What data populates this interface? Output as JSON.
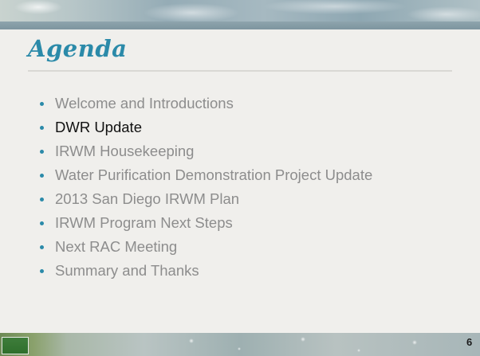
{
  "slide": {
    "title": "Agenda",
    "items": [
      {
        "label": "Welcome and Introductions",
        "active": false
      },
      {
        "label": "DWR Update",
        "active": true
      },
      {
        "label": "IRWM Housekeeping",
        "active": false
      },
      {
        "label": "Water Purification Demonstration Project Update",
        "active": false
      },
      {
        "label": "2013 San Diego IRWM Plan",
        "active": false
      },
      {
        "label": "IRWM Program Next Steps",
        "active": false
      },
      {
        "label": "Next RAC Meeting",
        "active": false
      },
      {
        "label": "Summary and Thanks",
        "active": false
      }
    ],
    "page_number": "6"
  },
  "colors": {
    "title": "#2b8aa9",
    "bullet": "#2b8aa9",
    "inactive_text": "#8d8d8d",
    "active_text": "#111111"
  }
}
